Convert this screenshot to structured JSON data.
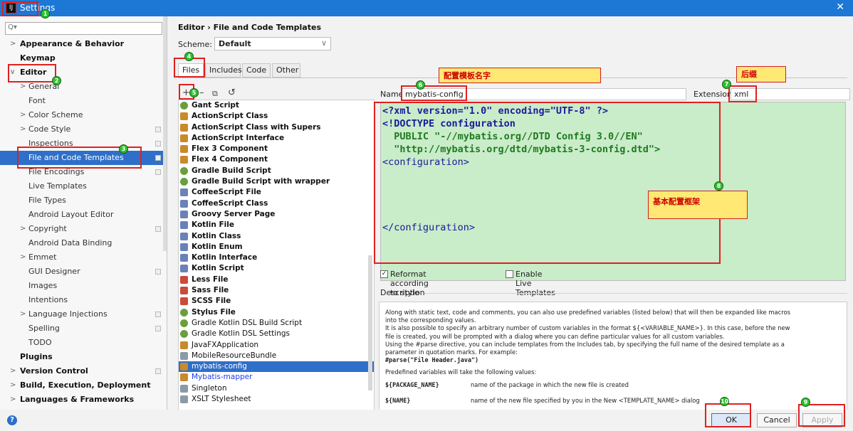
{
  "window": {
    "title": "Settings",
    "close_glyph": "✕"
  },
  "search": {
    "placeholder": "Q▾"
  },
  "sidebar": {
    "items": [
      {
        "label": "Appearance & Behavior",
        "level": 0,
        "arrow": ">",
        "bold": true
      },
      {
        "label": "Keymap",
        "level": 0,
        "arrow": "",
        "bold": true
      },
      {
        "label": "Editor",
        "level": 0,
        "arrow": "∨",
        "bold": true
      },
      {
        "label": "General",
        "level": 1,
        "arrow": ">"
      },
      {
        "label": "Font",
        "level": 1,
        "arrow": ""
      },
      {
        "label": "Color Scheme",
        "level": 1,
        "arrow": ">"
      },
      {
        "label": "Code Style",
        "level": 1,
        "arrow": ">",
        "copy": true
      },
      {
        "label": "Inspections",
        "level": 1,
        "arrow": "",
        "copy": true
      },
      {
        "label": "File and Code Templates",
        "level": 1,
        "arrow": "",
        "copy": true,
        "selected": true
      },
      {
        "label": "File Encodings",
        "level": 1,
        "arrow": "",
        "copy": true
      },
      {
        "label": "Live Templates",
        "level": 1,
        "arrow": ""
      },
      {
        "label": "File Types",
        "level": 1,
        "arrow": ""
      },
      {
        "label": "Android Layout Editor",
        "level": 1,
        "arrow": ""
      },
      {
        "label": "Copyright",
        "level": 1,
        "arrow": ">",
        "copy": true
      },
      {
        "label": "Android Data Binding",
        "level": 1,
        "arrow": ""
      },
      {
        "label": "Emmet",
        "level": 1,
        "arrow": ">"
      },
      {
        "label": "GUI Designer",
        "level": 1,
        "arrow": "",
        "copy": true
      },
      {
        "label": "Images",
        "level": 1,
        "arrow": ""
      },
      {
        "label": "Intentions",
        "level": 1,
        "arrow": ""
      },
      {
        "label": "Language Injections",
        "level": 1,
        "arrow": ">",
        "copy": true
      },
      {
        "label": "Spelling",
        "level": 1,
        "arrow": "",
        "copy": true
      },
      {
        "label": "TODO",
        "level": 1,
        "arrow": ""
      },
      {
        "label": "Plugins",
        "level": 0,
        "arrow": "",
        "bold": true
      },
      {
        "label": "Version Control",
        "level": 0,
        "arrow": ">",
        "bold": true,
        "copy": true
      },
      {
        "label": "Build, Execution, Deployment",
        "level": 0,
        "arrow": ">",
        "bold": true
      },
      {
        "label": "Languages & Frameworks",
        "level": 0,
        "arrow": ">",
        "bold": true
      }
    ]
  },
  "breadcrumb": {
    "text": "Editor  ›  File and Code Templates"
  },
  "scheme": {
    "label": "Scheme:",
    "value": "Default",
    "dropdown_glyph": "∨"
  },
  "tabs": [
    {
      "label": "Files",
      "active": true
    },
    {
      "label": "Includes"
    },
    {
      "label": "Code"
    },
    {
      "label": "Other"
    }
  ],
  "toolbar": {
    "add": "+",
    "remove": "–",
    "copy": "⧉",
    "reset": "↺"
  },
  "templates": [
    {
      "label": "Gant Script",
      "bold": true,
      "icon": "g"
    },
    {
      "label": "ActionScript Class",
      "bold": true,
      "icon": "o"
    },
    {
      "label": "ActionScript Class with Supers",
      "bold": true,
      "icon": "o"
    },
    {
      "label": "ActionScript Interface",
      "bold": true,
      "icon": "o"
    },
    {
      "label": "Flex 3 Component",
      "bold": true,
      "icon": "o"
    },
    {
      "label": "Flex 4 Component",
      "bold": true,
      "icon": "o"
    },
    {
      "label": "Gradle Build Script",
      "bold": true,
      "icon": "g"
    },
    {
      "label": "Gradle Build Script with wrapper",
      "bold": true,
      "icon": "g"
    },
    {
      "label": "CoffeeScript File",
      "bold": true,
      "icon": "k"
    },
    {
      "label": "CoffeeScript Class",
      "bold": true,
      "icon": "k"
    },
    {
      "label": "Groovy Server Page",
      "bold": true,
      "icon": "k"
    },
    {
      "label": "Kotlin File",
      "bold": true,
      "icon": "k"
    },
    {
      "label": "Kotlin Class",
      "bold": true,
      "icon": "k"
    },
    {
      "label": "Kotlin Enum",
      "bold": true,
      "icon": "k"
    },
    {
      "label": "Kotlin Interface",
      "bold": true,
      "icon": "k"
    },
    {
      "label": "Kotlin Script",
      "bold": true,
      "icon": "k"
    },
    {
      "label": "Less File",
      "bold": true,
      "icon": "r"
    },
    {
      "label": "Sass File",
      "bold": true,
      "icon": "r"
    },
    {
      "label": "SCSS File",
      "bold": true,
      "icon": "r"
    },
    {
      "label": "Stylus File",
      "bold": true,
      "icon": "g"
    },
    {
      "label": "Gradle Kotlin DSL Build Script",
      "bold": false,
      "icon": "g"
    },
    {
      "label": "Gradle Kotlin DSL Settings",
      "bold": false,
      "icon": "g"
    },
    {
      "label": "JavaFXApplication",
      "bold": false,
      "icon": "o"
    },
    {
      "label": "MobileResourceBundle",
      "bold": false,
      "icon": ""
    },
    {
      "label": "mybatis-config",
      "bold": false,
      "icon": "o",
      "selected": true
    },
    {
      "label": "Mybatis-mapper",
      "bold": false,
      "icon": "o",
      "blue": true
    },
    {
      "label": "Singleton",
      "bold": false,
      "icon": ""
    },
    {
      "label": "XSLT Stylesheet",
      "bold": false,
      "icon": ""
    }
  ],
  "name_field": {
    "label": "Name:",
    "value": "mybatis-config"
  },
  "extension_field": {
    "label": "Extension:",
    "value": "xml"
  },
  "editor": {
    "lines": [
      {
        "text": "<?xml version=\"1.0\" encoding=\"UTF-8\" ?>",
        "style": "k"
      },
      {
        "text": "<!DOCTYPE configuration",
        "style": "k"
      },
      {
        "text": "  PUBLIC \"-//mybatis.org//DTD Config 3.0//EN\"",
        "style": "s"
      },
      {
        "text": "  \"http://mybatis.org/dtd/mybatis-3-config.dtd\">",
        "style": "s"
      },
      {
        "text": "<configuration>",
        "style": ""
      },
      {
        "text": "",
        "style": ""
      },
      {
        "text": "",
        "style": ""
      },
      {
        "text": "",
        "style": ""
      },
      {
        "text": "",
        "style": ""
      },
      {
        "text": "</configuration>",
        "style": ""
      }
    ]
  },
  "options": {
    "reformat": "Reformat according to style",
    "reformat_checked": true,
    "live_templates": "Enable Live Templates",
    "live_checked": false
  },
  "description": {
    "title": "Description",
    "paras": [
      "Along with static text, code and comments, you can also use predefined variables (listed below) that will then be expanded like macros",
      "into the corresponding values.",
      "It is also possible to specify an arbitrary number of custom variables in the format ${<VARIABLE_NAME>}. In this case, before the new",
      "file is created, you will be prompted with a dialog where you can define particular values for all custom variables.",
      "Using the #parse directive, you can include templates from the Includes tab, by specifying the full name of the desired template as a",
      "parameter in quotation marks. For example:"
    ],
    "example": "#parse(\"File Header.java\")",
    "predefined_intro": "Predefined variables will take the following values:",
    "vars": [
      {
        "name": "${PACKAGE_NAME}",
        "desc": "name of the package in which the new file is created"
      },
      {
        "name": "${NAME}",
        "desc": "name of the new file specified by you in the New <TEMPLATE_NAME> dialog"
      }
    ]
  },
  "buttons": {
    "ok": "OK",
    "cancel": "Cancel",
    "apply": "Apply",
    "help": "?"
  },
  "annotations": {
    "notes": [
      "配置模板名字",
      "后缀",
      "基本配置框架"
    ],
    "badges": [
      "1",
      "2",
      "3",
      "4",
      "5",
      "6",
      "7",
      "8",
      "9",
      "10"
    ]
  }
}
